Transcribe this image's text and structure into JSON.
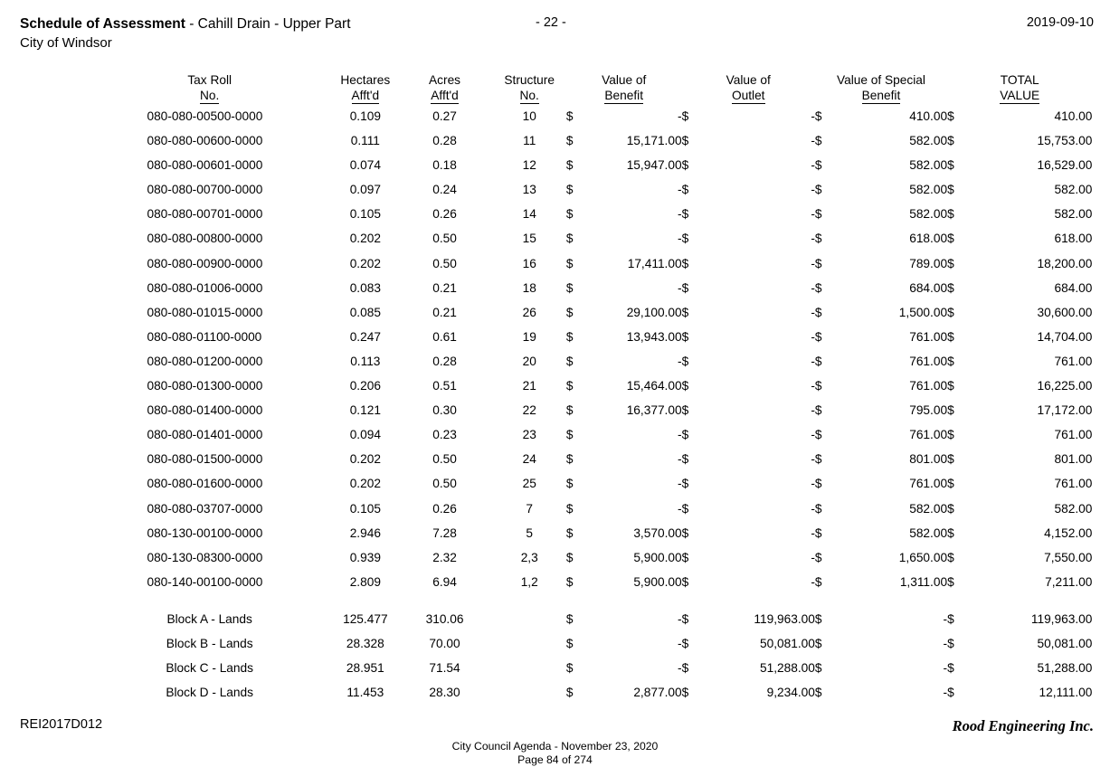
{
  "header": {
    "title_strong": "Schedule of Assessment",
    "title_rest": " - Cahill Drain - Upper Part",
    "subtitle": "City of Windsor",
    "page_marker": "- 22 -",
    "date": "2019-09-10"
  },
  "table": {
    "columns": [
      {
        "line1": "Tax Roll",
        "line2": "No."
      },
      {
        "line1": "Hectares",
        "line2": "Afft'd"
      },
      {
        "line1": "Acres",
        "line2": "Afft'd"
      },
      {
        "line1": "Structure",
        "line2": "No."
      },
      {
        "line1": "Value of",
        "line2": "Benefit"
      },
      {
        "line1": "Value of",
        "line2": "Outlet"
      },
      {
        "line1": "Value of Special",
        "line2": "Benefit"
      },
      {
        "line1": "TOTAL",
        "line2": "VALUE"
      }
    ],
    "currency_symbol": "$",
    "zero_dash": "-",
    "rows": [
      {
        "tax_roll": "080-080-00500-0000",
        "hectares": "0.109",
        "acres": "0.27",
        "structure": "10",
        "benefit": "-",
        "outlet": "-",
        "special_benefit": "410.00",
        "total": "410.00"
      },
      {
        "tax_roll": "080-080-00600-0000",
        "hectares": "0.111",
        "acres": "0.28",
        "structure": "11",
        "benefit": "15,171.00",
        "outlet": "-",
        "special_benefit": "582.00",
        "total": "15,753.00"
      },
      {
        "tax_roll": "080-080-00601-0000",
        "hectares": "0.074",
        "acres": "0.18",
        "structure": "12",
        "benefit": "15,947.00",
        "outlet": "-",
        "special_benefit": "582.00",
        "total": "16,529.00"
      },
      {
        "tax_roll": "080-080-00700-0000",
        "hectares": "0.097",
        "acres": "0.24",
        "structure": "13",
        "benefit": "-",
        "outlet": "-",
        "special_benefit": "582.00",
        "total": "582.00"
      },
      {
        "tax_roll": "080-080-00701-0000",
        "hectares": "0.105",
        "acres": "0.26",
        "structure": "14",
        "benefit": "-",
        "outlet": "-",
        "special_benefit": "582.00",
        "total": "582.00"
      },
      {
        "tax_roll": "080-080-00800-0000",
        "hectares": "0.202",
        "acres": "0.50",
        "structure": "15",
        "benefit": "-",
        "outlet": "-",
        "special_benefit": "618.00",
        "total": "618.00"
      },
      {
        "tax_roll": "080-080-00900-0000",
        "hectares": "0.202",
        "acres": "0.50",
        "structure": "16",
        "benefit": "17,411.00",
        "outlet": "-",
        "special_benefit": "789.00",
        "total": "18,200.00"
      },
      {
        "tax_roll": "080-080-01006-0000",
        "hectares": "0.083",
        "acres": "0.21",
        "structure": "18",
        "benefit": "-",
        "outlet": "-",
        "special_benefit": "684.00",
        "total": "684.00"
      },
      {
        "tax_roll": "080-080-01015-0000",
        "hectares": "0.085",
        "acres": "0.21",
        "structure": "26",
        "benefit": "29,100.00",
        "outlet": "-",
        "special_benefit": "1,500.00",
        "total": "30,600.00"
      },
      {
        "tax_roll": "080-080-01100-0000",
        "hectares": "0.247",
        "acres": "0.61",
        "structure": "19",
        "benefit": "13,943.00",
        "outlet": "-",
        "special_benefit": "761.00",
        "total": "14,704.00"
      },
      {
        "tax_roll": "080-080-01200-0000",
        "hectares": "0.113",
        "acres": "0.28",
        "structure": "20",
        "benefit": "-",
        "outlet": "-",
        "special_benefit": "761.00",
        "total": "761.00"
      },
      {
        "tax_roll": "080-080-01300-0000",
        "hectares": "0.206",
        "acres": "0.51",
        "structure": "21",
        "benefit": "15,464.00",
        "outlet": "-",
        "special_benefit": "761.00",
        "total": "16,225.00"
      },
      {
        "tax_roll": "080-080-01400-0000",
        "hectares": "0.121",
        "acres": "0.30",
        "structure": "22",
        "benefit": "16,377.00",
        "outlet": "-",
        "special_benefit": "795.00",
        "total": "17,172.00"
      },
      {
        "tax_roll": "080-080-01401-0000",
        "hectares": "0.094",
        "acres": "0.23",
        "structure": "23",
        "benefit": "-",
        "outlet": "-",
        "special_benefit": "761.00",
        "total": "761.00"
      },
      {
        "tax_roll": "080-080-01500-0000",
        "hectares": "0.202",
        "acres": "0.50",
        "structure": "24",
        "benefit": "-",
        "outlet": "-",
        "special_benefit": "801.00",
        "total": "801.00"
      },
      {
        "tax_roll": "080-080-01600-0000",
        "hectares": "0.202",
        "acres": "0.50",
        "structure": "25",
        "benefit": "-",
        "outlet": "-",
        "special_benefit": "761.00",
        "total": "761.00"
      },
      {
        "tax_roll": "080-080-03707-0000",
        "hectares": "0.105",
        "acres": "0.26",
        "structure": "7",
        "benefit": "-",
        "outlet": "-",
        "special_benefit": "582.00",
        "total": "582.00"
      },
      {
        "tax_roll": "080-130-00100-0000",
        "hectares": "2.946",
        "acres": "7.28",
        "structure": "5",
        "benefit": "3,570.00",
        "outlet": "-",
        "special_benefit": "582.00",
        "total": "4,152.00"
      },
      {
        "tax_roll": "080-130-08300-0000",
        "hectares": "0.939",
        "acres": "2.32",
        "structure": "2,3",
        "benefit": "5,900.00",
        "outlet": "-",
        "special_benefit": "1,650.00",
        "total": "7,550.00"
      },
      {
        "tax_roll": "080-140-00100-0000",
        "hectares": "2.809",
        "acres": "6.94",
        "structure": "1,2",
        "benefit": "5,900.00",
        "outlet": "-",
        "special_benefit": "1,311.00",
        "total": "7,211.00"
      }
    ],
    "block_rows": [
      {
        "tax_roll": "Block A - Lands",
        "hectares": "125.477",
        "acres": "310.06",
        "structure": "",
        "benefit": "-",
        "outlet": "119,963.00",
        "special_benefit": "-",
        "total": "119,963.00"
      },
      {
        "tax_roll": "Block B - Lands",
        "hectares": "28.328",
        "acres": "70.00",
        "structure": "",
        "benefit": "-",
        "outlet": "50,081.00",
        "special_benefit": "-",
        "total": "50,081.00"
      },
      {
        "tax_roll": "Block C - Lands",
        "hectares": "28.951",
        "acres": "71.54",
        "structure": "",
        "benefit": "-",
        "outlet": "51,288.00",
        "special_benefit": "-",
        "total": "51,288.00"
      },
      {
        "tax_roll": "Block D - Lands",
        "hectares": "11.453",
        "acres": "28.30",
        "structure": "",
        "benefit": "2,877.00",
        "outlet": "9,234.00",
        "special_benefit": "-",
        "total": "12,111.00"
      }
    ]
  },
  "footer": {
    "reference": "REI2017D012",
    "company": "Rood Engineering Inc.",
    "agenda_line1": "City Council Agenda - November 23, 2020",
    "agenda_line2": "Page 84 of 274"
  }
}
